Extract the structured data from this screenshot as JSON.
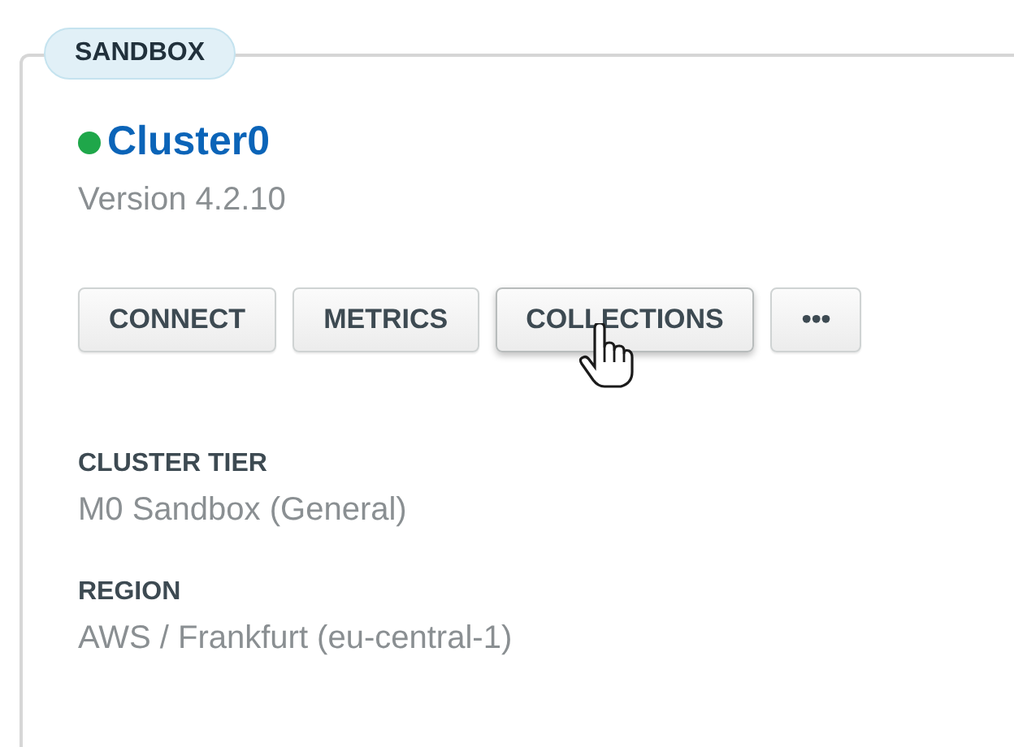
{
  "badge": "SANDBOX",
  "cluster": {
    "name": "Cluster0",
    "color": "#1fa74a",
    "version": "Version 4.2.10"
  },
  "buttons": [
    {
      "label": "CONNECT",
      "hovered": false
    },
    {
      "label": "METRICS",
      "hovered": false
    },
    {
      "label": "COLLECTIONS",
      "hovered": true
    },
    {
      "label": "•••",
      "hovered": false
    }
  ],
  "details": [
    {
      "label": "CLUSTER TIER",
      "value": "M0 Sandbox (General)"
    },
    {
      "label": "REGION",
      "value": "AWS / Frankfurt (eu-central-1)"
    }
  ]
}
